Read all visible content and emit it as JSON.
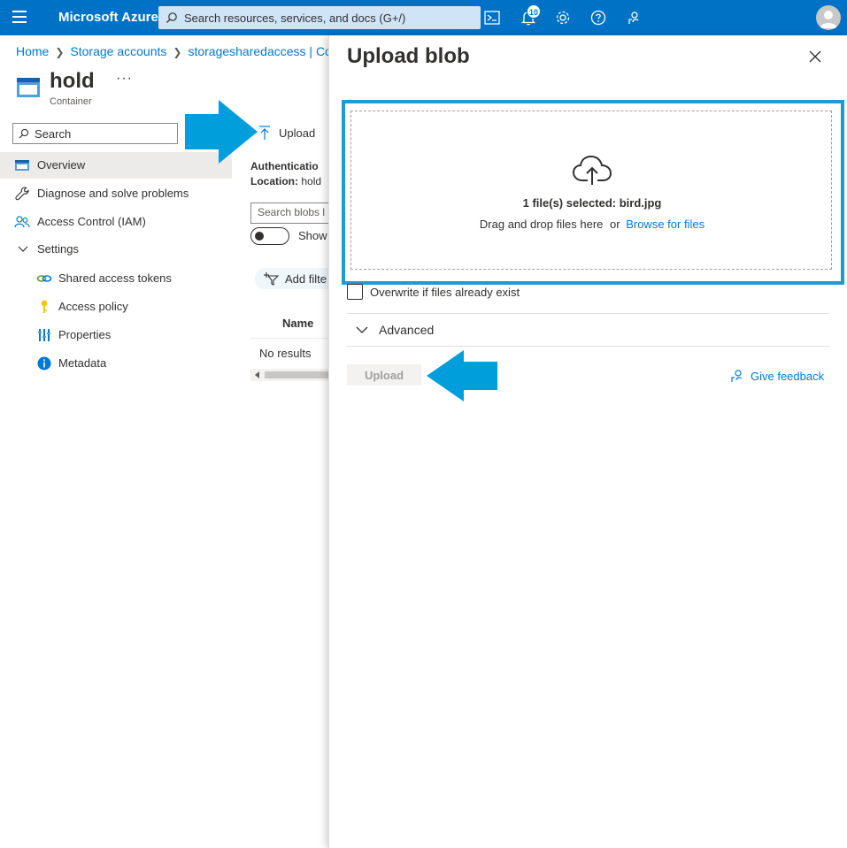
{
  "topbar": {
    "brand": "Microsoft Azure",
    "search_placeholder": "Search resources, services, and docs (G+/)",
    "notification_count": "10"
  },
  "breadcrumb": {
    "items": [
      "Home",
      "Storage accounts",
      "storagesharedaccess | Cont"
    ]
  },
  "resource": {
    "title": "hold",
    "more": "···",
    "type": "Container"
  },
  "nav": {
    "search_placeholder": "Search",
    "items": [
      {
        "label": "Overview",
        "icon": "container-icon"
      },
      {
        "label": "Diagnose and solve problems",
        "icon": "wrench-icon"
      },
      {
        "label": "Access Control (IAM)",
        "icon": "people-icon"
      },
      {
        "label": "Settings",
        "icon": "chevron-down-icon"
      },
      {
        "label": "Shared access tokens",
        "icon": "link-icon"
      },
      {
        "label": "Access policy",
        "icon": "key-icon"
      },
      {
        "label": "Properties",
        "icon": "properties-icon"
      },
      {
        "label": "Metadata",
        "icon": "info-icon"
      }
    ]
  },
  "content": {
    "upload_label": "Upload",
    "auth_label": "Authenticatio",
    "location_label": "Location:",
    "location_value": "hold",
    "blob_search_placeholder": "Search blobs l",
    "show_label": "Show",
    "add_filter_label": "Add filte",
    "col_name": "Name",
    "no_results": "No results"
  },
  "panel": {
    "title": "Upload blob",
    "selected_text": "1 file(s) selected: bird.jpg",
    "drag_text": "Drag and drop files here",
    "or_text": "or",
    "browse_text": "Browse for files",
    "overwrite_label": "Overwrite if files already exist",
    "advanced_label": "Advanced",
    "upload_button": "Upload",
    "feedback_label": "Give feedback"
  },
  "colors": {
    "topbar": "#0072c6",
    "accent": "#0078d4",
    "highlight_frame": "#1e9bd7",
    "arrow": "#009edb"
  }
}
